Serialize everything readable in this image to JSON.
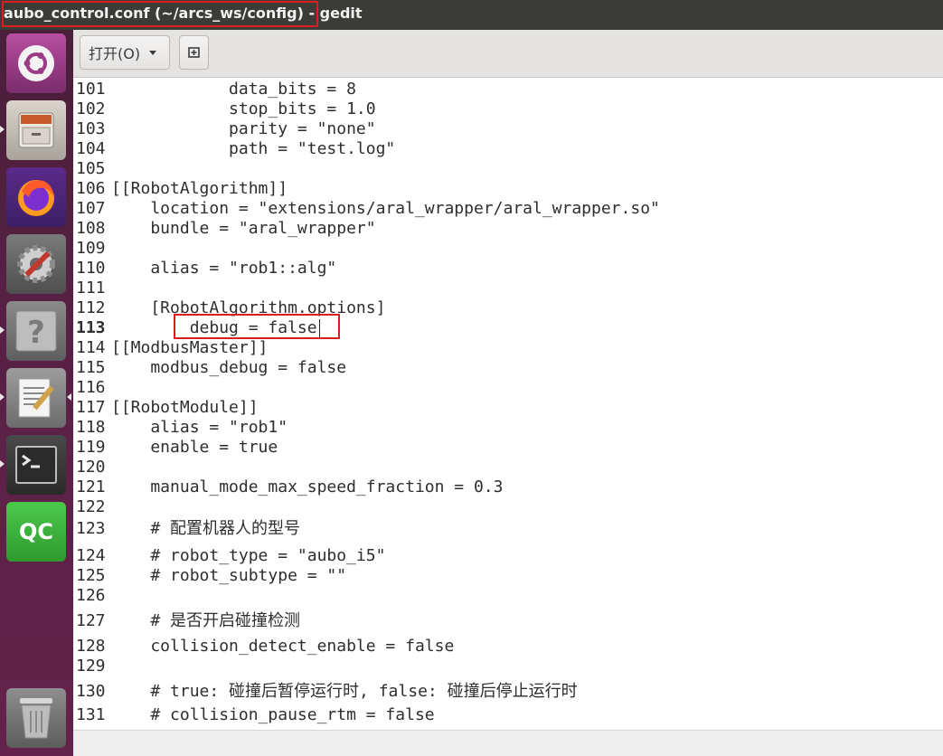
{
  "window": {
    "title_file": "aubo_control.conf (~/arcs_ws/config)",
    "title_sep": " - ",
    "title_app": "gedit"
  },
  "toolbar": {
    "open_label": "打开(O)",
    "new_icon": "new-document-icon"
  },
  "launcher": [
    {
      "name": "ubuntu-dash-icon"
    },
    {
      "name": "files-icon"
    },
    {
      "name": "firefox-icon"
    },
    {
      "name": "system-settings-icon"
    },
    {
      "name": "help-icon"
    },
    {
      "name": "text-editor-icon"
    },
    {
      "name": "terminal-icon"
    },
    {
      "name": "qt-creator-icon"
    },
    {
      "name": "trash-icon"
    }
  ],
  "editor": {
    "current_line": "113",
    "lines": [
      {
        "n": "101",
        "t": "            data_bits = 8"
      },
      {
        "n": "102",
        "t": "            stop_bits = 1.0"
      },
      {
        "n": "103",
        "t": "            parity = \"none\""
      },
      {
        "n": "104",
        "t": "            path = \"test.log\""
      },
      {
        "n": "105",
        "t": ""
      },
      {
        "n": "106",
        "t": "[[RobotAlgorithm]]"
      },
      {
        "n": "107",
        "t": "    location = \"extensions/aral_wrapper/aral_wrapper.so\""
      },
      {
        "n": "108",
        "t": "    bundle = \"aral_wrapper\""
      },
      {
        "n": "109",
        "t": ""
      },
      {
        "n": "110",
        "t": "    alias = \"rob1::alg\""
      },
      {
        "n": "111",
        "t": ""
      },
      {
        "n": "112",
        "t": "    [RobotAlgorithm.options]"
      },
      {
        "n": "113",
        "t": "        debug = false"
      },
      {
        "n": "114",
        "t": "[[ModbusMaster]]"
      },
      {
        "n": "115",
        "t": "    modbus_debug = false"
      },
      {
        "n": "116",
        "t": ""
      },
      {
        "n": "117",
        "t": "[[RobotModule]]"
      },
      {
        "n": "118",
        "t": "    alias = \"rob1\""
      },
      {
        "n": "119",
        "t": "    enable = true"
      },
      {
        "n": "120",
        "t": ""
      },
      {
        "n": "121",
        "t": "    manual_mode_max_speed_fraction = 0.3"
      },
      {
        "n": "122",
        "t": ""
      },
      {
        "n": "123",
        "t": "    # 配置机器人的型号"
      },
      {
        "n": "124",
        "t": "    # robot_type = \"aubo_i5\""
      },
      {
        "n": "125",
        "t": "    # robot_subtype = \"\""
      },
      {
        "n": "126",
        "t": ""
      },
      {
        "n": "127",
        "t": "    # 是否开启碰撞检测"
      },
      {
        "n": "128",
        "t": "    collision_detect_enable = false"
      },
      {
        "n": "129",
        "t": ""
      },
      {
        "n": "130",
        "t": "    # true: 碰撞后暂停运行时, false: 碰撞后停止运行时"
      },
      {
        "n": "131",
        "t": "    # collision_pause_rtm = false"
      }
    ]
  },
  "colors": {
    "highlight_box": "#d81e1e",
    "launcher_bg": "#5d2148",
    "titlebar_bg": "#3b3b38"
  }
}
